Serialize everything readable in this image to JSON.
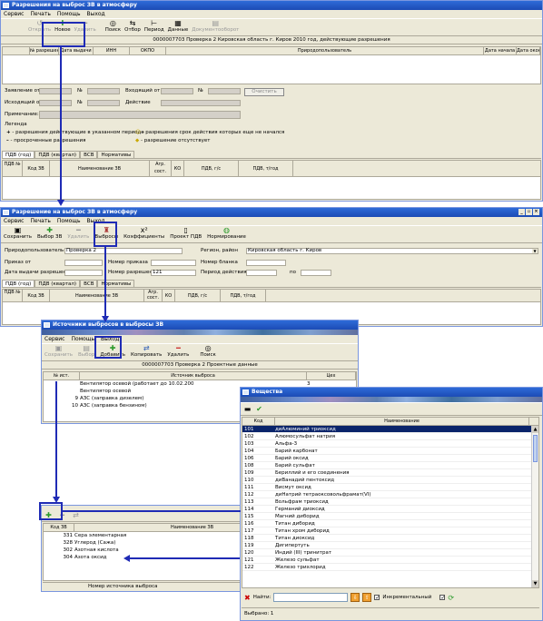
{
  "w1": {
    "title": "Разрешения на выброс ЗВ в атмосферу",
    "menu": [
      "Сервис",
      "Печать",
      "Помощь",
      "Выход"
    ],
    "toolbar": [
      "Открыть",
      "Новое",
      "Удалить",
      "Поиск",
      "Отбор",
      "Период",
      "Данные",
      "Документооборот"
    ],
    "info": "0000007703  Проверка 2  Кировская область г. Киров 2010 год, действующие разрешения",
    "cols": [
      "№ разрешения",
      "Дата выдачи",
      "ИНН",
      "ОКПО",
      "Природопользователь",
      "Дата начала",
      "Дата окон"
    ],
    "f_zayavl": "Заявление от",
    "f_no": "№",
    "f_vhod": "Входящий от",
    "f_ishod": "Исходящий от",
    "f_deystv": "Действие",
    "f_prim": "Примечание:",
    "btn_clear": "Очистить",
    "legend_title": "Легенда",
    "legend": [
      "- разрешения действующие в указанном периоде",
      "- разрешения срок действия которых еще не начался",
      "- просроченные разрешения",
      "- разрешение отсутствует"
    ],
    "tabs": [
      "ПДВ (год)",
      "ПДВ (квартал)",
      "ВСВ",
      "Нормативы"
    ],
    "gcols": [
      "ПДВ №",
      "Код ЗВ",
      "Наименование ЗВ",
      "Агр. сост.",
      "КО",
      "ПДВ, г/с",
      "ПДВ, т/год"
    ]
  },
  "w2": {
    "title": "Разрешение на выброс ЗВ в атмосферу",
    "menu": [
      "Сервис",
      "Печать",
      "Помощь",
      "Выход"
    ],
    "toolbar": [
      "Сохранить",
      "Выбор ЗВ",
      "Удалить",
      "Выбросы",
      "Коэффициенты",
      "Проект ПДВ",
      "Нормирование"
    ],
    "f_pp": "Природопользователь",
    "f_pp_val": "Проверка 2",
    "f_region": "Регион, район",
    "f_region_val": "Кировская область г. Киров",
    "f_prikaz_ot": "Приказ от",
    "f_prikaz_no": "Номер приказа",
    "f_blank": "Номер бланка",
    "f_data": "Дата выдачи разрешения",
    "f_razr_no": "Номер разрешения",
    "f_razr_val": "121",
    "f_period": "Период действия с",
    "f_po": "по",
    "tabs": [
      "ПДВ (год)",
      "ПДВ (квартал)",
      "ВСВ",
      "Нормативы"
    ],
    "gcols": [
      "ПДВ №",
      "Код ЗВ",
      "Наименование ЗВ",
      "Агр. сост.",
      "КО",
      "ПДВ, г/с",
      "ПДВ, т/год"
    ]
  },
  "w3": {
    "title": "Источники выбросов в выбросы ЗВ",
    "menu": [
      "Сервис",
      "Помощь",
      "Выход"
    ],
    "toolbar": [
      "Сохранить",
      "Выбор",
      "Добавить",
      "Копировать",
      "Удалить",
      "Поиск"
    ],
    "info": "0000007703  Проверка 2  Проектные данные",
    "cols": [
      "№ ист.",
      "Источник выброса",
      "Цех"
    ],
    "rows": [
      {
        "no": "",
        "name": "Вентилятор осевой (работает до 10.02.200",
        "ceh": "3"
      },
      {
        "no": "",
        "name": "Вентилятор осевой",
        "ceh": ""
      },
      {
        "no": "9",
        "name": "АЗС (заправка дизелем)",
        "ceh": ""
      },
      {
        "no": "10",
        "name": "АЗС (заправка бензином)",
        "ceh": ""
      }
    ]
  },
  "w4": {
    "cols": [
      "Код ЗВ",
      "Наименование ЗВ"
    ],
    "rows": [
      {
        "code": "331",
        "name": "Сера элементарная"
      },
      {
        "code": "328",
        "name": "Углерод (Сажа)"
      },
      {
        "code": "302",
        "name": "Азотная кислота"
      },
      {
        "code": "304",
        "name": "Азота оксид"
      }
    ],
    "footer": "Номер источника выброса"
  },
  "w5": {
    "title": "Вещества",
    "cols": [
      "Код",
      "Наименование"
    ],
    "rows": [
      {
        "code": "101",
        "name": "диАлюминий триоксид"
      },
      {
        "code": "102",
        "name": "Алюмосульфат натрия"
      },
      {
        "code": "103",
        "name": "Альфа-3"
      },
      {
        "code": "104",
        "name": "Барий карбонат"
      },
      {
        "code": "106",
        "name": "Барий оксид"
      },
      {
        "code": "108",
        "name": "Барий сульфат"
      },
      {
        "code": "109",
        "name": "Бериллий и его соединения"
      },
      {
        "code": "110",
        "name": "диВанадий пентоксид"
      },
      {
        "code": "111",
        "name": "Висмут оксид"
      },
      {
        "code": "112",
        "name": "диНатрий тетраоксовольфрамат(VI)"
      },
      {
        "code": "113",
        "name": "Вольфрам триоксид"
      },
      {
        "code": "114",
        "name": "Германий диоксид"
      },
      {
        "code": "115",
        "name": "Магний диборид"
      },
      {
        "code": "116",
        "name": "Титан диборид"
      },
      {
        "code": "117",
        "name": "Титан хром диборид"
      },
      {
        "code": "118",
        "name": "Титан диоксид"
      },
      {
        "code": "119",
        "name": "Дигипертуть"
      },
      {
        "code": "120",
        "name": "Индий (III) тринитрат"
      },
      {
        "code": "121",
        "name": "Железо сульфат"
      },
      {
        "code": "122",
        "name": "Железо трихлорид"
      }
    ],
    "search_label": "Найти:",
    "incremental": "Инкрементальный",
    "status": "Выбрано: 1"
  }
}
